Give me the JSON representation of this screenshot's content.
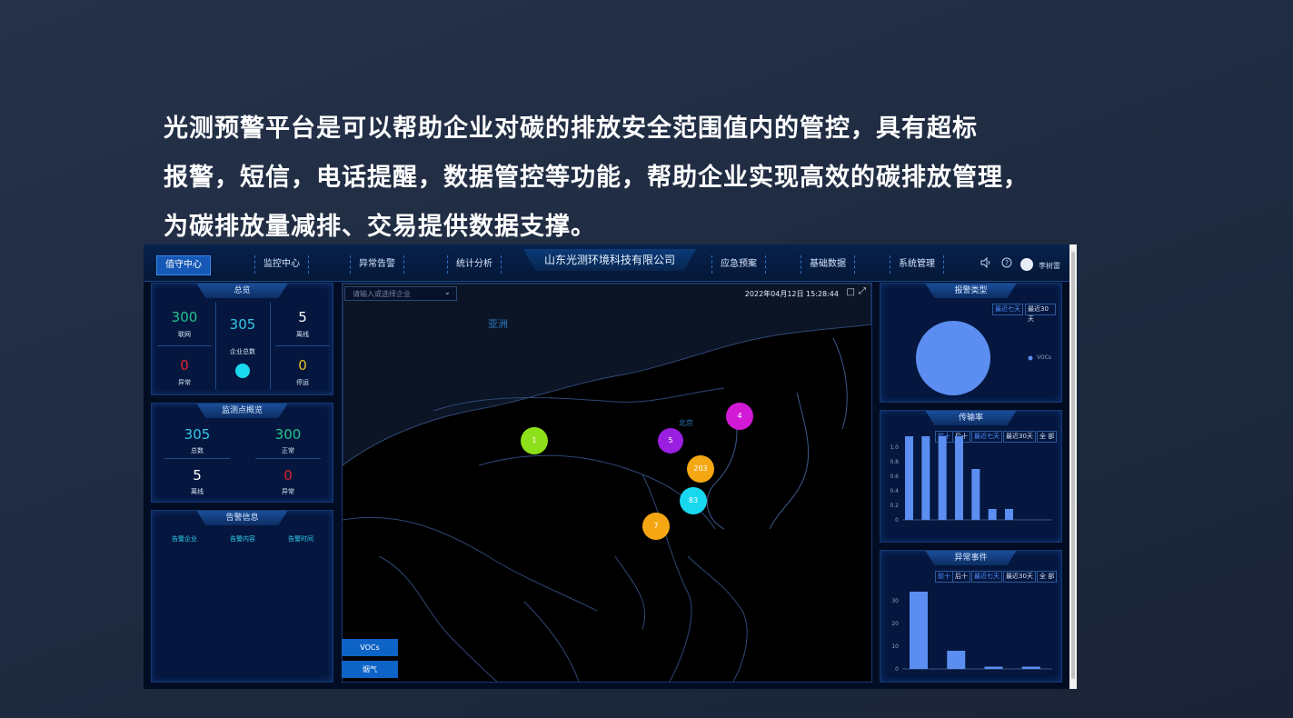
{
  "intro": {
    "line1": "光测预警平台是可以帮助企业对碳的排放安全范围值内的管控，具有超标",
    "line2": "报警，短信，电话提醒，数据管控等功能，帮助企业实现高效的碳排放管理，",
    "line3": "为碳排放量减排、交易提供数据支撑。"
  },
  "app": {
    "brand": "山东光测环境科技有限公司",
    "nav_left": [
      "值守中心",
      "监控中心",
      "异常告警",
      "统计分析"
    ],
    "nav_right": [
      "应急预案",
      "基础数据",
      "系统管理"
    ],
    "active_nav": "值守中心",
    "user": "李树雷",
    "colors": {
      "accent": "#1558b5",
      "green": "#22c38e",
      "cyan": "#33c7e8",
      "red": "#e0252c",
      "yellow": "#e6c21c"
    }
  },
  "overview": {
    "title": "总览",
    "online_value": "300",
    "online_label": "联网",
    "total_value": "305",
    "total_label": "企业总数",
    "offline_value": "5",
    "offline_label": "离线",
    "abnormal_value": "0",
    "abnormal_label": "异常",
    "stopped_value": "0",
    "stopped_label": "停运"
  },
  "monitor": {
    "title": "监测点概览",
    "total_value": "305",
    "total_label": "总数",
    "normal_value": "300",
    "normal_label": "正常",
    "offline_value": "5",
    "offline_label": "离线",
    "abnormal_value": "0",
    "abnormal_label": "异常"
  },
  "alerts": {
    "title": "告警信息",
    "col1": "告警企业",
    "col2": "告警内容",
    "col3": "告警时间"
  },
  "map": {
    "search_placeholder": "请输入或选择企业",
    "datetime": "2022年04月12日 15:28:44",
    "region_label": "亚洲",
    "city_label": "北京",
    "clusters": [
      {
        "value": "1",
        "color": "#8ee01a"
      },
      {
        "value": "5",
        "color": "#9a1fe0"
      },
      {
        "value": "4",
        "color": "#d21ad6"
      },
      {
        "value": "203",
        "color": "#f5a713"
      },
      {
        "value": "83",
        "color": "#18d8ef"
      },
      {
        "value": "7",
        "color": "#f5a713"
      }
    ],
    "layer_buttons": [
      "VOCs",
      "烟气"
    ]
  },
  "alarm_type": {
    "title": "报警类型",
    "range_a": "最近七天",
    "range_b": "最近30天",
    "legend": "VOCs",
    "chart_data": {
      "type": "pie",
      "categories": [
        "VOCs"
      ],
      "values": [
        100
      ]
    }
  },
  "transfer": {
    "title": "传输率",
    "filters": [
      "前十",
      "后十",
      "最近七天",
      "最近30天",
      "全 部"
    ],
    "chart_data": {
      "type": "bar",
      "values": [
        1.15,
        1.15,
        1.15,
        1.15,
        0.7,
        0.15,
        0.15
      ],
      "ylim": [
        0,
        1.2
      ],
      "yticks": [
        "1.0",
        "0.8",
        "0.6",
        "0.4",
        "0.2",
        "0"
      ]
    }
  },
  "events": {
    "title": "异常事件",
    "filters": [
      "前十",
      "后十",
      "最近七天",
      "最近30天",
      "全 部"
    ],
    "chart_data": {
      "type": "bar",
      "values": [
        34,
        8,
        1,
        1
      ],
      "ylim": [
        0,
        38
      ],
      "yticks": [
        "30",
        "20",
        "10",
        "0"
      ]
    }
  }
}
